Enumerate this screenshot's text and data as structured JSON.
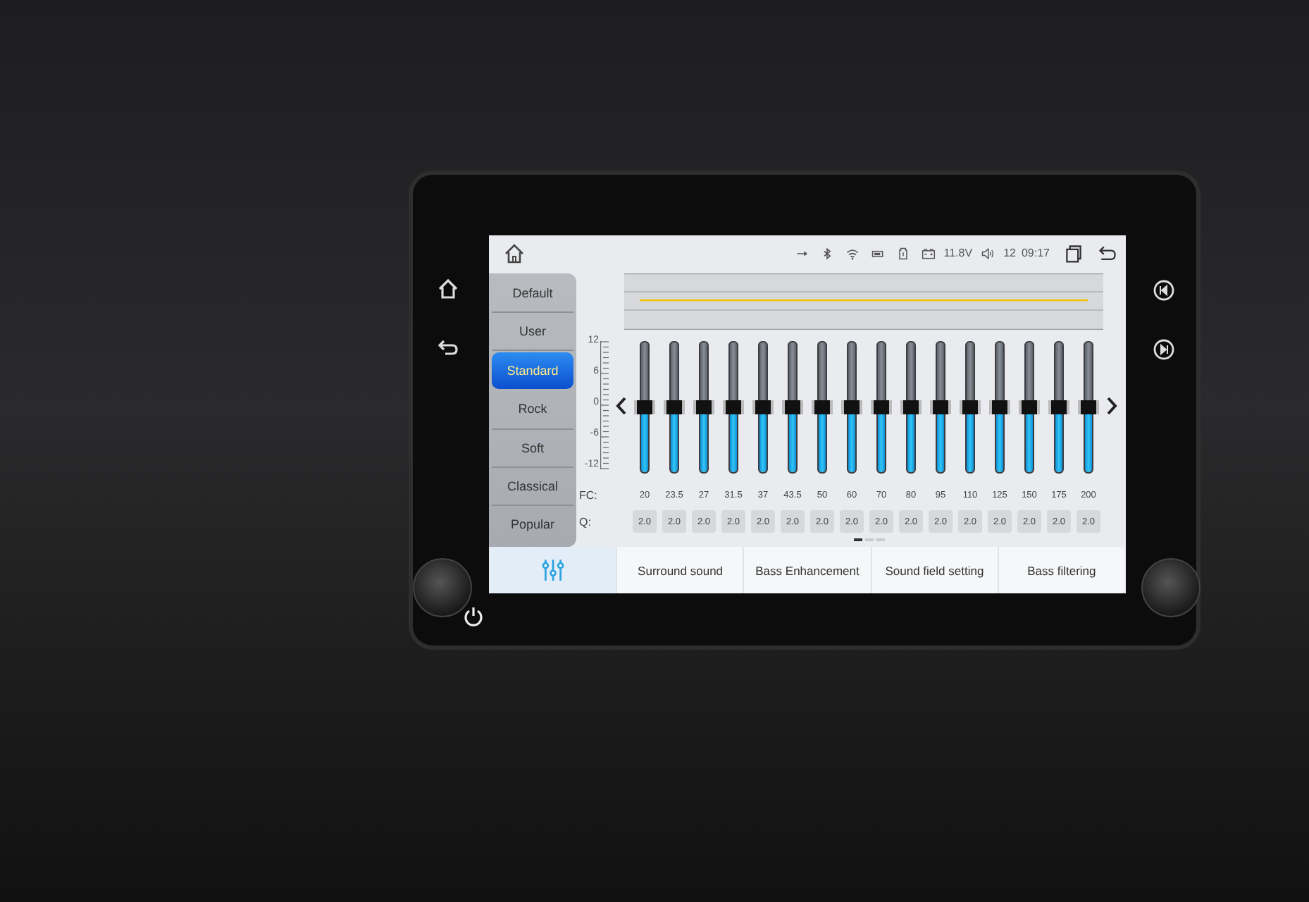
{
  "status_bar": {
    "voltage": "11.8V",
    "volume": "12",
    "time": "09:17"
  },
  "presets": [
    {
      "label": "Default",
      "selected": false
    },
    {
      "label": "User",
      "selected": false
    },
    {
      "label": "Standard",
      "selected": true
    },
    {
      "label": "Rock",
      "selected": false
    },
    {
      "label": "Soft",
      "selected": false
    },
    {
      "label": "Classical",
      "selected": false
    },
    {
      "label": "Popular",
      "selected": false
    }
  ],
  "scale": [
    "12",
    "6",
    "0",
    "-6",
    "-12"
  ],
  "fc_label": "FC:",
  "q_label": "Q:",
  "bands": [
    {
      "fc": "20",
      "q": "2.0",
      "level": 0.5
    },
    {
      "fc": "23.5",
      "q": "2.0",
      "level": 0.5
    },
    {
      "fc": "27",
      "q": "2.0",
      "level": 0.5
    },
    {
      "fc": "31.5",
      "q": "2.0",
      "level": 0.5
    },
    {
      "fc": "37",
      "q": "2.0",
      "level": 0.5
    },
    {
      "fc": "43.5",
      "q": "2.0",
      "level": 0.5
    },
    {
      "fc": "50",
      "q": "2.0",
      "level": 0.5
    },
    {
      "fc": "60",
      "q": "2.0",
      "level": 0.5
    },
    {
      "fc": "70",
      "q": "2.0",
      "level": 0.5
    },
    {
      "fc": "80",
      "q": "2.0",
      "level": 0.5
    },
    {
      "fc": "95",
      "q": "2.0",
      "level": 0.5
    },
    {
      "fc": "110",
      "q": "2.0",
      "level": 0.5
    },
    {
      "fc": "125",
      "q": "2.0",
      "level": 0.5
    },
    {
      "fc": "150",
      "q": "2.0",
      "level": 0.5
    },
    {
      "fc": "175",
      "q": "2.0",
      "level": 0.5
    },
    {
      "fc": "200",
      "q": "2.0",
      "level": 0.5
    }
  ],
  "pages": [
    {
      "selected": true
    },
    {
      "selected": false
    },
    {
      "selected": false
    }
  ],
  "tabs": [
    {
      "kind": "icon",
      "selected": true
    },
    {
      "kind": "text",
      "label": "Surround sound",
      "selected": false
    },
    {
      "kind": "text",
      "label": "Bass Enhancement",
      "selected": false
    },
    {
      "kind": "text",
      "label": "Sound field setting",
      "selected": false
    },
    {
      "kind": "text",
      "label": "Bass filtering",
      "selected": false
    }
  ]
}
